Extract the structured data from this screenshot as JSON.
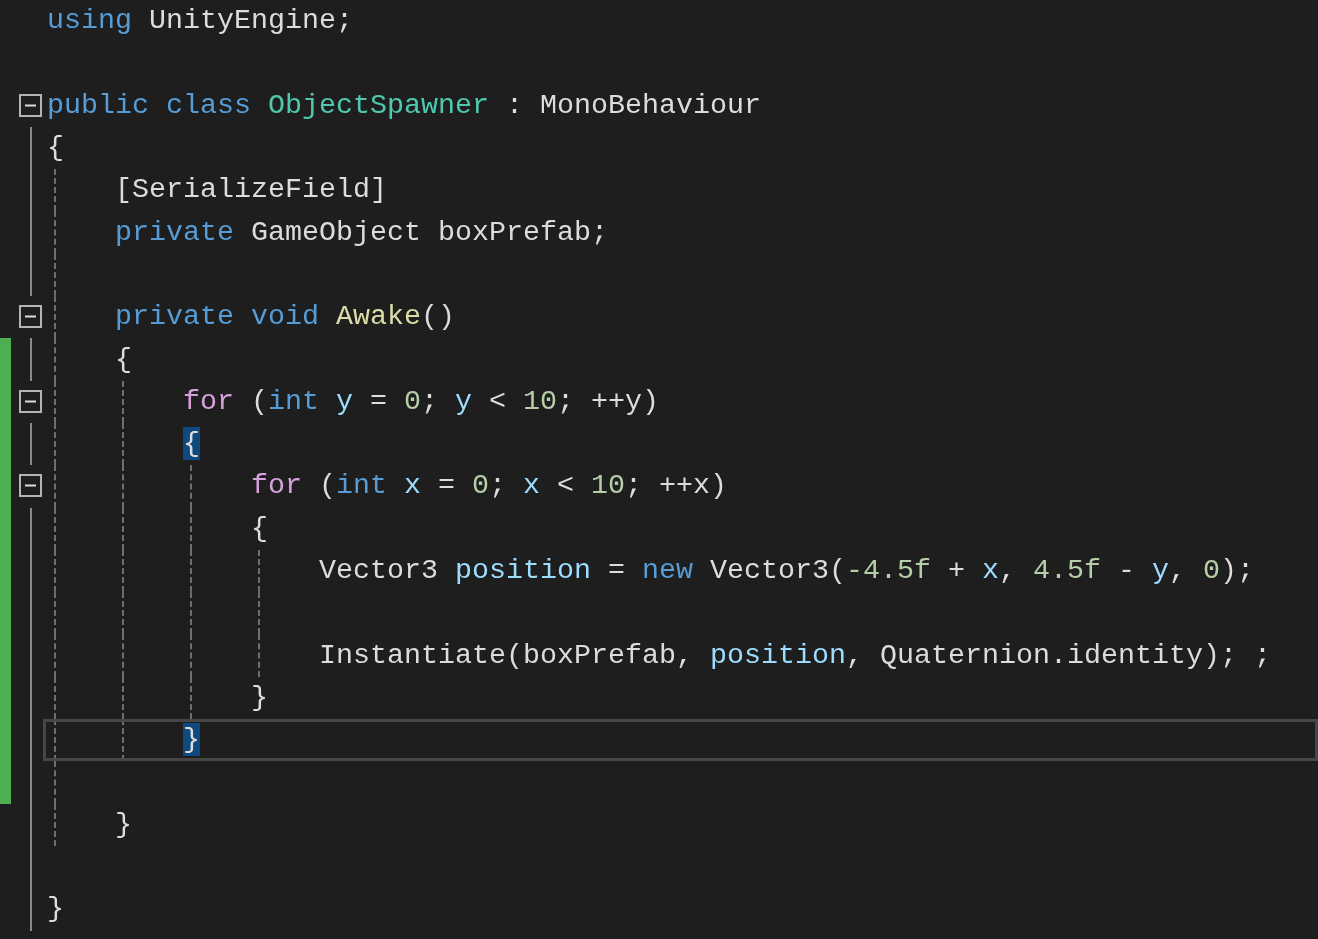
{
  "editor": {
    "lines": [
      {
        "changed": false,
        "current": false,
        "tokens": [
          {
            "kind": "keyword",
            "text": "using"
          },
          {
            "kind": "plain",
            "text": " UnityEngine;"
          }
        ]
      },
      {
        "changed": false,
        "current": false
      },
      {
        "expanded": true,
        "changed": false,
        "current": false,
        "tokens": [
          {
            "kind": "keyword",
            "text": "public class "
          },
          {
            "kind": "type",
            "text": "ObjectSpawner"
          },
          {
            "kind": "plain",
            "text": " : MonoBehaviour"
          }
        ]
      },
      {
        "changed": false,
        "current": false,
        "tokens": [
          {
            "kind": "plain",
            "text": "{"
          }
        ]
      },
      {
        "changed": false,
        "current": false,
        "tokens": [
          {
            "kind": "plain",
            "text": "    [SerializeField]"
          }
        ]
      },
      {
        "changed": false,
        "current": false,
        "tokens": [
          {
            "kind": "keyword",
            "text": "    private"
          },
          {
            "kind": "plain",
            "text": " GameObject boxPrefab;"
          }
        ]
      },
      {
        "changed": false,
        "current": false
      },
      {
        "expanded": true,
        "changed": false,
        "current": false,
        "tokens": [
          {
            "kind": "keyword",
            "text": "    private void "
          },
          {
            "kind": "method",
            "text": "Awake"
          },
          {
            "kind": "plain",
            "text": "()"
          }
        ]
      },
      {
        "changed": true,
        "current": false,
        "tokens": [
          {
            "kind": "plain",
            "text": "    {"
          }
        ]
      },
      {
        "expanded": true,
        "changed": true,
        "current": false,
        "tokens": [
          {
            "kind": "control",
            "text": "        for"
          },
          {
            "kind": "plain",
            "text": " ("
          },
          {
            "kind": "keyword",
            "text": "int "
          },
          {
            "kind": "variable",
            "text": "y"
          },
          {
            "kind": "plain",
            "text": " = "
          },
          {
            "kind": "number",
            "text": "0"
          },
          {
            "kind": "plain",
            "text": "; "
          },
          {
            "kind": "variable",
            "text": "y"
          },
          {
            "kind": "plain",
            "text": " < "
          },
          {
            "kind": "number",
            "text": "10"
          },
          {
            "kind": "plain",
            "text": "; ++y)"
          }
        ]
      },
      {
        "changed": true,
        "current": false,
        "tokens": [
          {
            "kind": "matched-brace",
            "text": "        {"
          }
        ]
      },
      {
        "expanded": true,
        "changed": true,
        "current": false,
        "tokens": [
          {
            "kind": "control",
            "text": "            for"
          },
          {
            "kind": "plain",
            "text": " ("
          },
          {
            "kind": "keyword",
            "text": "int "
          },
          {
            "kind": "variable",
            "text": "x"
          },
          {
            "kind": "plain",
            "text": " = "
          },
          {
            "kind": "number",
            "text": "0"
          },
          {
            "kind": "plain",
            "text": "; "
          },
          {
            "kind": "variable",
            "text": "x"
          },
          {
            "kind": "plain",
            "text": " < "
          },
          {
            "kind": "number",
            "text": "10"
          },
          {
            "kind": "plain",
            "text": "; ++x)"
          }
        ]
      },
      {
        "changed": true,
        "current": false,
        "tokens": [
          {
            "kind": "plain",
            "text": "            {"
          }
        ]
      },
      {
        "changed": true,
        "current": false,
        "tokens": [
          {
            "kind": "plain",
            "text": "                Vector3 "
          },
          {
            "kind": "variable",
            "text": "position"
          },
          {
            "kind": "plain",
            "text": " = "
          },
          {
            "kind": "keyword",
            "text": "new"
          },
          {
            "kind": "plain",
            "text": " Vector3("
          },
          {
            "kind": "number",
            "text": "-4.5f"
          },
          {
            "kind": "plain",
            "text": " + "
          },
          {
            "kind": "variable",
            "text": "x"
          },
          {
            "kind": "plain",
            "text": ", "
          },
          {
            "kind": "number",
            "text": "4.5f"
          },
          {
            "kind": "plain",
            "text": " - "
          },
          {
            "kind": "variable",
            "text": "y"
          },
          {
            "kind": "plain",
            "text": ", "
          },
          {
            "kind": "number",
            "text": "0"
          },
          {
            "kind": "plain",
            "text": ");"
          }
        ]
      },
      {
        "changed": true,
        "current": false
      },
      {
        "changed": true,
        "current": false,
        "tokens": [
          {
            "kind": "plain",
            "text": "                Instantiate(boxPrefab, "
          },
          {
            "kind": "variable",
            "text": "position"
          },
          {
            "kind": "plain",
            "text": ", Quaternion.identity); ;"
          }
        ]
      },
      {
        "changed": true,
        "current": false,
        "tokens": [
          {
            "kind": "plain",
            "text": "            }"
          }
        ]
      },
      {
        "changed": true,
        "current": true,
        "tokens": [
          {
            "kind": "matched-brace",
            "text": "        }"
          }
        ]
      },
      {
        "changed": true,
        "current": false
      },
      {
        "changed": false,
        "current": false,
        "tokens": [
          {
            "kind": "plain",
            "text": "    }"
          }
        ]
      },
      {
        "changed": false,
        "current": false
      },
      {
        "changed": false,
        "current": false,
        "tokens": [
          {
            "kind": "plain",
            "text": "}"
          }
        ]
      }
    ]
  }
}
